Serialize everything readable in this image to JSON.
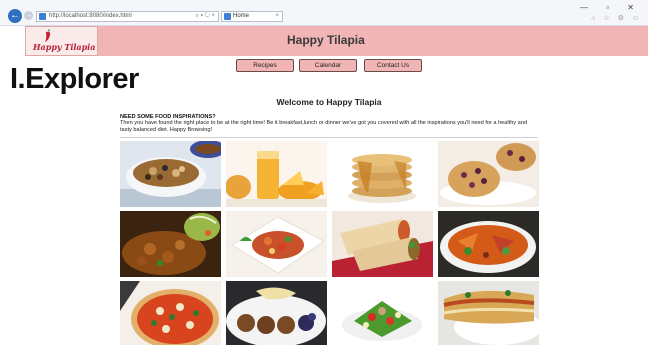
{
  "browser": {
    "url": "http://localhost:8080/index.html",
    "tab_title": "Home",
    "address_controls": "⌕ ▾ ↻ ×",
    "tab_close": "×",
    "window_controls": "—  ▫  ✕",
    "toolbar_icons": "⌂ ☆ ⚙ ☺"
  },
  "header": {
    "logo_text": "Happy Tilapia",
    "site_title": "Happy Tilapia"
  },
  "nav": {
    "items": [
      {
        "label": "Recipes"
      },
      {
        "label": "Calendar"
      },
      {
        "label": "Contact Us"
      }
    ]
  },
  "overlay_caption": "I.Explorer",
  "main": {
    "welcome_heading": "Welcome to Happy Tilapia",
    "intro_heading": "NEED SOME FOOD INSPIRATIONS?",
    "intro_text": "Then you have found the right place to be at the right time! Be it breakfast,lunch or dinner we've got you covered with all the inspirations you'll need for a healthy and tasty balanced diet. Happy Browsing!"
  },
  "gallery": {
    "items": [
      {
        "name": "bean-soup-bowl-image"
      },
      {
        "name": "mango-juice-image"
      },
      {
        "name": "pancakes-image"
      },
      {
        "name": "muffins-image"
      },
      {
        "name": "curry-stew-image"
      },
      {
        "name": "salad-plate-image"
      },
      {
        "name": "wrap-sandwich-image"
      },
      {
        "name": "roasted-vegetables-image"
      },
      {
        "name": "pizza-image"
      },
      {
        "name": "meatballs-image"
      },
      {
        "name": "tuna-salad-image"
      },
      {
        "name": "lasagna-image"
      }
    ]
  },
  "colors": {
    "header_bg": "#f2b5b5",
    "nav_bg": "#f2b5b5",
    "logo_red": "#b8203a",
    "browser_blue": "#2f6fc2"
  }
}
